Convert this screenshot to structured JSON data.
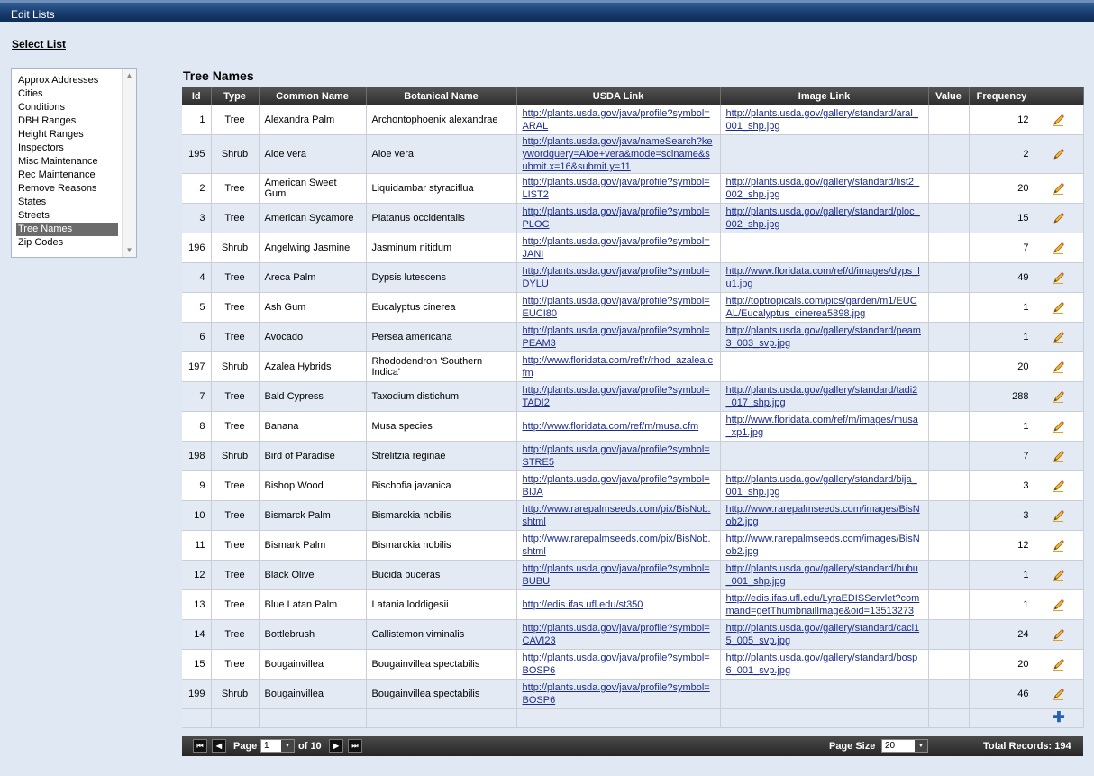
{
  "window": {
    "title": "Edit Lists"
  },
  "select_list": {
    "label": "Select List",
    "items": [
      "Approx Addresses",
      "Cities",
      "Conditions",
      "DBH Ranges",
      "Height Ranges",
      "Inspectors",
      "Misc Maintenance",
      "Rec Maintenance",
      "Remove Reasons",
      "States",
      "Streets",
      "Tree Names",
      "Zip Codes"
    ],
    "selected": "Tree Names"
  },
  "grid": {
    "title": "Tree Names",
    "columns": [
      "Id",
      "Type",
      "Common Name",
      "Botanical Name",
      "USDA Link",
      "Image Link",
      "Value",
      "Frequency"
    ],
    "rows": [
      {
        "id": "1",
        "type": "Tree",
        "common": "Alexandra Palm",
        "botanical": "Archontophoenix alexandrae",
        "usda": "http://plants.usda.gov/java/profile?symbol=ARAL",
        "image": "http://plants.usda.gov/gallery/standard/aral_001_shp.jpg",
        "value": "",
        "frequency": "12"
      },
      {
        "id": "195",
        "type": "Shrub",
        "common": "Aloe vera",
        "botanical": "Aloe vera",
        "usda": "http://plants.usda.gov/java/nameSearch?keywordquery=Aloe+vera&mode=sciname&submit.x=16&submit.y=11",
        "image": "",
        "value": "",
        "frequency": "2"
      },
      {
        "id": "2",
        "type": "Tree",
        "common": "American Sweet Gum",
        "botanical": "Liquidambar styraciflua",
        "usda": "http://plants.usda.gov/java/profile?symbol=LIST2",
        "image": "http://plants.usda.gov/gallery/standard/list2_002_shp.jpg",
        "value": "",
        "frequency": "20"
      },
      {
        "id": "3",
        "type": "Tree",
        "common": "American Sycamore",
        "botanical": "Platanus occidentalis",
        "usda": "http://plants.usda.gov/java/profile?symbol=PLOC",
        "image": "http://plants.usda.gov/gallery/standard/ploc_002_shp.jpg",
        "value": "",
        "frequency": "15"
      },
      {
        "id": "196",
        "type": "Shrub",
        "common": "Angelwing Jasmine",
        "botanical": "Jasminum nitidum",
        "usda": "http://plants.usda.gov/java/profile?symbol=JANI",
        "image": "",
        "value": "",
        "frequency": "7"
      },
      {
        "id": "4",
        "type": "Tree",
        "common": "Areca Palm",
        "botanical": "Dypsis lutescens",
        "usda": "http://plants.usda.gov/java/profile?symbol=DYLU",
        "image": "http://www.floridata.com/ref/d/images/dyps_lu1.jpg",
        "value": "",
        "frequency": "49"
      },
      {
        "id": "5",
        "type": "Tree",
        "common": "Ash Gum",
        "botanical": "Eucalyptus cinerea",
        "usda": "http://plants.usda.gov/java/profile?symbol=EUCI80",
        "image": "http://toptropicals.com/pics/garden/m1/EUCAL/Eucalyptus_cinerea5898.jpg",
        "value": "",
        "frequency": "1"
      },
      {
        "id": "6",
        "type": "Tree",
        "common": "Avocado",
        "botanical": "Persea americana",
        "usda": "http://plants.usda.gov/java/profile?symbol=PEAM3",
        "image": "http://plants.usda.gov/gallery/standard/peam3_003_svp.jpg",
        "value": "",
        "frequency": "1"
      },
      {
        "id": "197",
        "type": "Shrub",
        "common": "Azalea Hybrids",
        "botanical": "Rhododendron 'Southern Indica'",
        "usda": "http://www.floridata.com/ref/r/rhod_azalea.cfm",
        "image": "",
        "value": "",
        "frequency": "20"
      },
      {
        "id": "7",
        "type": "Tree",
        "common": "Bald Cypress",
        "botanical": "Taxodium distichum",
        "usda": "http://plants.usda.gov/java/profile?symbol=TADI2",
        "image": "http://plants.usda.gov/gallery/standard/tadi2_017_shp.jpg",
        "value": "",
        "frequency": "288"
      },
      {
        "id": "8",
        "type": "Tree",
        "common": "Banana",
        "botanical": "Musa species",
        "usda": "http://www.floridata.com/ref/m/musa.cfm",
        "image": "http://www.floridata.com/ref/m/images/musa_xp1.jpg",
        "value": "",
        "frequency": "1"
      },
      {
        "id": "198",
        "type": "Shrub",
        "common": "Bird of Paradise",
        "botanical": "Strelitzia reginae",
        "usda": "http://plants.usda.gov/java/profile?symbol=STRE5",
        "image": "",
        "value": "",
        "frequency": "7"
      },
      {
        "id": "9",
        "type": "Tree",
        "common": "Bishop Wood",
        "botanical": "Bischofia javanica",
        "usda": "http://plants.usda.gov/java/profile?symbol=BIJA",
        "image": "http://plants.usda.gov/gallery/standard/bija_001_shp.jpg",
        "value": "",
        "frequency": "3"
      },
      {
        "id": "10",
        "type": "Tree",
        "common": "Bismarck Palm",
        "botanical": "Bismarckia nobilis",
        "usda": "http://www.rarepalmseeds.com/pix/BisNob.shtml",
        "image": "http://www.rarepalmseeds.com/images/BisNob2.jpg",
        "value": "",
        "frequency": "3"
      },
      {
        "id": "11",
        "type": "Tree",
        "common": "Bismark Palm",
        "botanical": "Bismarckia nobilis",
        "usda": "http://www.rarepalmseeds.com/pix/BisNob.shtml",
        "image": "http://www.rarepalmseeds.com/images/BisNob2.jpg",
        "value": "",
        "frequency": "12"
      },
      {
        "id": "12",
        "type": "Tree",
        "common": "Black Olive",
        "botanical": "Bucida buceras",
        "usda": "http://plants.usda.gov/java/profile?symbol=BUBU",
        "image": "http://plants.usda.gov/gallery/standard/bubu_001_shp.jpg",
        "value": "",
        "frequency": "1"
      },
      {
        "id": "13",
        "type": "Tree",
        "common": "Blue Latan Palm",
        "botanical": "Latania loddigesii",
        "usda": "http://edis.ifas.ufl.edu/st350",
        "image": "http://edis.ifas.ufl.edu/LyraEDISServlet?command=getThumbnailImage&oid=13513273",
        "value": "",
        "frequency": "1"
      },
      {
        "id": "14",
        "type": "Tree",
        "common": "Bottlebrush",
        "botanical": "Callistemon viminalis",
        "usda": "http://plants.usda.gov/java/profile?symbol=CAVI23",
        "image": "http://plants.usda.gov/gallery/standard/caci15_005_svp.jpg",
        "value": "",
        "frequency": "24"
      },
      {
        "id": "15",
        "type": "Tree",
        "common": "Bougainvillea",
        "botanical": "Bougainvillea spectabilis",
        "usda": "http://plants.usda.gov/java/profile?symbol=BOSP6",
        "image": "http://plants.usda.gov/gallery/standard/bosp6_001_svp.jpg",
        "value": "",
        "frequency": "20"
      },
      {
        "id": "199",
        "type": "Shrub",
        "common": "Bougainvillea",
        "botanical": "Bougainvillea spectabilis",
        "usda": "http://plants.usda.gov/java/profile?symbol=BOSP6",
        "image": "",
        "value": "",
        "frequency": "46"
      }
    ]
  },
  "pager": {
    "page_label": "Page",
    "current_page": "1",
    "of_label": "of 10",
    "page_size_label": "Page Size",
    "page_size": "20",
    "total_records": "Total Records: 194"
  },
  "icons": {
    "edit": "pencil-icon",
    "add": "plus-icon",
    "first": "first-page-icon",
    "prev": "prev-page-icon",
    "next": "next-page-icon",
    "last": "last-page-icon"
  },
  "colors": {
    "title_bar": "#163a6a",
    "background": "#dfe8f3",
    "header": "#2d2d2d",
    "link": "#1c2c8c",
    "alt_row": "#e3eaf4",
    "selected_item": "#6b6b6b"
  }
}
